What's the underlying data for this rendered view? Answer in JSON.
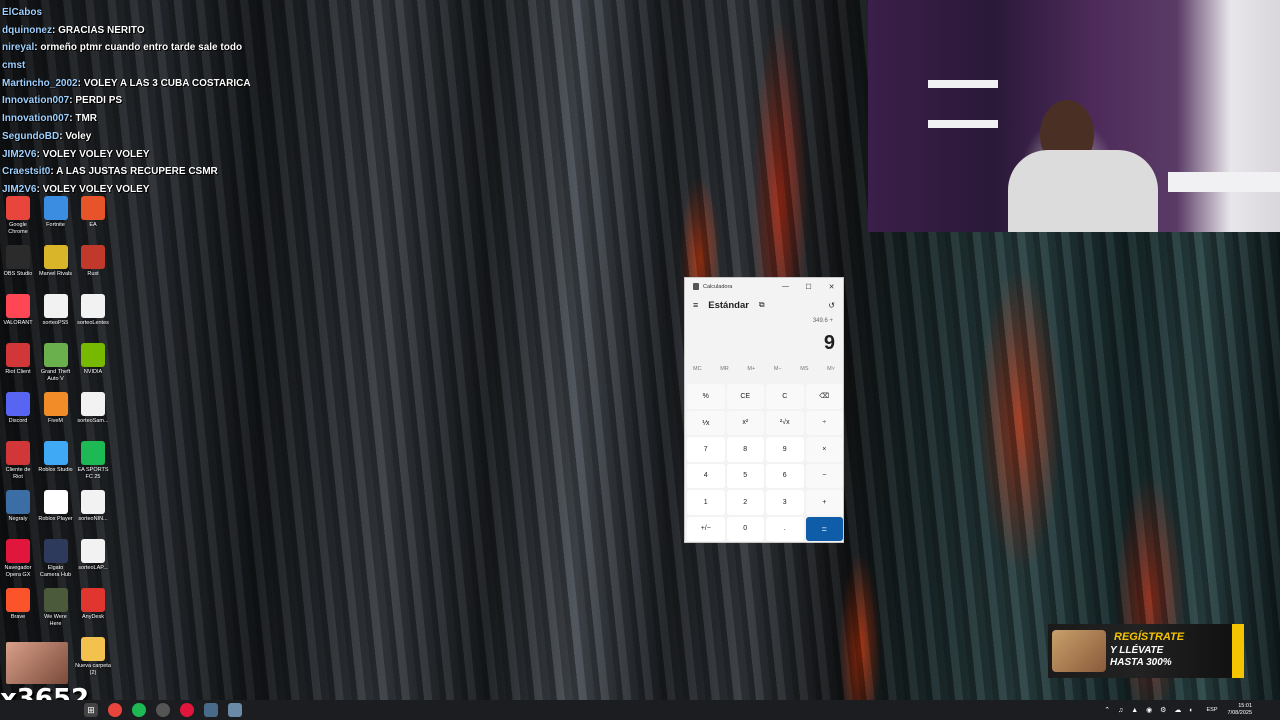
{
  "chat": [
    {
      "user": "ElCabos",
      "text": ""
    },
    {
      "user": "dquinonez",
      "text": ": GRACIAS NERITO"
    },
    {
      "user": "nireyal",
      "text": ": ormeño ptmr cuando entro tarde sale todo"
    },
    {
      "user": "cmst",
      "text": ""
    },
    {
      "user": "Martincho_2002",
      "text": ": VOLEY A LAS 3 CUBA COSTARICA"
    },
    {
      "user": "Innovation007",
      "text": ": PERDI PS"
    },
    {
      "user": "Innovation007",
      "text": ": TMR"
    },
    {
      "user": "SegundoBD",
      "text": ": Voley"
    },
    {
      "user": "JIM2V6",
      "text": ": VOLEY VOLEY VOLEY"
    },
    {
      "user": "Craestsit0",
      "text": ": A LAS JUSTAS RECUPERE CSMR"
    },
    {
      "user": "JIM2V6",
      "text": ": VOLEY VOLEY VOLEY"
    }
  ],
  "desktop_icons": [
    {
      "label": "Google Chrome",
      "color": "#e8453c",
      "col": 0,
      "row": 0
    },
    {
      "label": "Fortnite",
      "color": "#3a8de0",
      "col": 1,
      "row": 0
    },
    {
      "label": "EA",
      "color": "#e8542a",
      "col": 2,
      "row": 0
    },
    {
      "label": "OBS Studio",
      "color": "#2b2b2b",
      "col": 0,
      "row": 1
    },
    {
      "label": "Marvel Rivals",
      "color": "#d9b52a",
      "col": 1,
      "row": 1
    },
    {
      "label": "Rust",
      "color": "#c0392b",
      "col": 2,
      "row": 1
    },
    {
      "label": "VALORANT",
      "color": "#ff4655",
      "col": 0,
      "row": 2
    },
    {
      "label": "sorteoPS5",
      "color": "#f2f2f2",
      "col": 1,
      "row": 2
    },
    {
      "label": "sorteoLentes",
      "color": "#f2f2f2",
      "col": 2,
      "row": 2
    },
    {
      "label": "Riot Client",
      "color": "#d13639",
      "col": 0,
      "row": 3
    },
    {
      "label": "Grand Theft Auto V",
      "color": "#6ab04c",
      "col": 1,
      "row": 3
    },
    {
      "label": "NVIDIA",
      "color": "#76b900",
      "col": 2,
      "row": 3
    },
    {
      "label": "Discord",
      "color": "#5865f2",
      "col": 0,
      "row": 4
    },
    {
      "label": "FiveM",
      "color": "#f28c28",
      "col": 1,
      "row": 4
    },
    {
      "label": "sorteoSam...",
      "color": "#f2f2f2",
      "col": 2,
      "row": 4
    },
    {
      "label": "Cliente de Riot",
      "color": "#d13639",
      "col": 0,
      "row": 5
    },
    {
      "label": "Roblox Studio",
      "color": "#3fa9f5",
      "col": 1,
      "row": 5
    },
    {
      "label": "EA SPORTS FC 25",
      "color": "#1db954",
      "col": 2,
      "row": 5
    },
    {
      "label": "Negraly",
      "color": "#3a6ea5",
      "col": 0,
      "row": 6
    },
    {
      "label": "Roblox Player",
      "color": "#ffffff",
      "col": 1,
      "row": 6
    },
    {
      "label": "sorteoNIN...",
      "color": "#f2f2f2",
      "col": 2,
      "row": 6
    },
    {
      "label": "Navegador Opera GX",
      "color": "#e0163c",
      "col": 0,
      "row": 7
    },
    {
      "label": "Elgato Camera Hub",
      "color": "#2d3a5c",
      "col": 1,
      "row": 7
    },
    {
      "label": "sorteoLAP...",
      "color": "#f2f2f2",
      "col": 2,
      "row": 7
    },
    {
      "label": "Brave",
      "color": "#fb542b",
      "col": 0,
      "row": 8
    },
    {
      "label": "We Were Here",
      "color": "#4a5a3a",
      "col": 1,
      "row": 8
    },
    {
      "label": "AnyDesk",
      "color": "#e1352f",
      "col": 2,
      "row": 8
    },
    {
      "label": "Nueva carpeta (2)",
      "color": "#f2c14e",
      "col": 2,
      "row": 9
    }
  ],
  "calculator": {
    "window_title": "Calculadora",
    "mode": "Estándar",
    "expression": "349.6 +",
    "display": "9",
    "memory": [
      "MC",
      "MR",
      "M+",
      "M−",
      "MS",
      "M˅"
    ],
    "keys": [
      {
        "label": "%",
        "type": "op"
      },
      {
        "label": "CE",
        "type": "op"
      },
      {
        "label": "C",
        "type": "op"
      },
      {
        "label": "⌫",
        "type": "op"
      },
      {
        "label": "⅟x",
        "type": "op"
      },
      {
        "label": "x²",
        "type": "op"
      },
      {
        "label": "²√x",
        "type": "op"
      },
      {
        "label": "÷",
        "type": "op"
      },
      {
        "label": "7",
        "type": "num"
      },
      {
        "label": "8",
        "type": "num"
      },
      {
        "label": "9",
        "type": "num"
      },
      {
        "label": "×",
        "type": "op"
      },
      {
        "label": "4",
        "type": "num"
      },
      {
        "label": "5",
        "type": "num"
      },
      {
        "label": "6",
        "type": "num"
      },
      {
        "label": "−",
        "type": "op"
      },
      {
        "label": "1",
        "type": "num"
      },
      {
        "label": "2",
        "type": "num"
      },
      {
        "label": "3",
        "type": "num"
      },
      {
        "label": "+",
        "type": "op"
      },
      {
        "label": "+/−",
        "type": "num"
      },
      {
        "label": "0",
        "type": "num"
      },
      {
        "label": ".",
        "type": "num"
      },
      {
        "label": "=",
        "type": "eq"
      }
    ]
  },
  "promo": {
    "line1": "REGÍSTRATE",
    "line2": "Y LLÉVATE",
    "line3": "HASTA 300%"
  },
  "overlay": {
    "viewer_count": "x3652"
  },
  "tray": {
    "lang": "ESP",
    "time": "15:01",
    "date": "7/08/2025"
  }
}
